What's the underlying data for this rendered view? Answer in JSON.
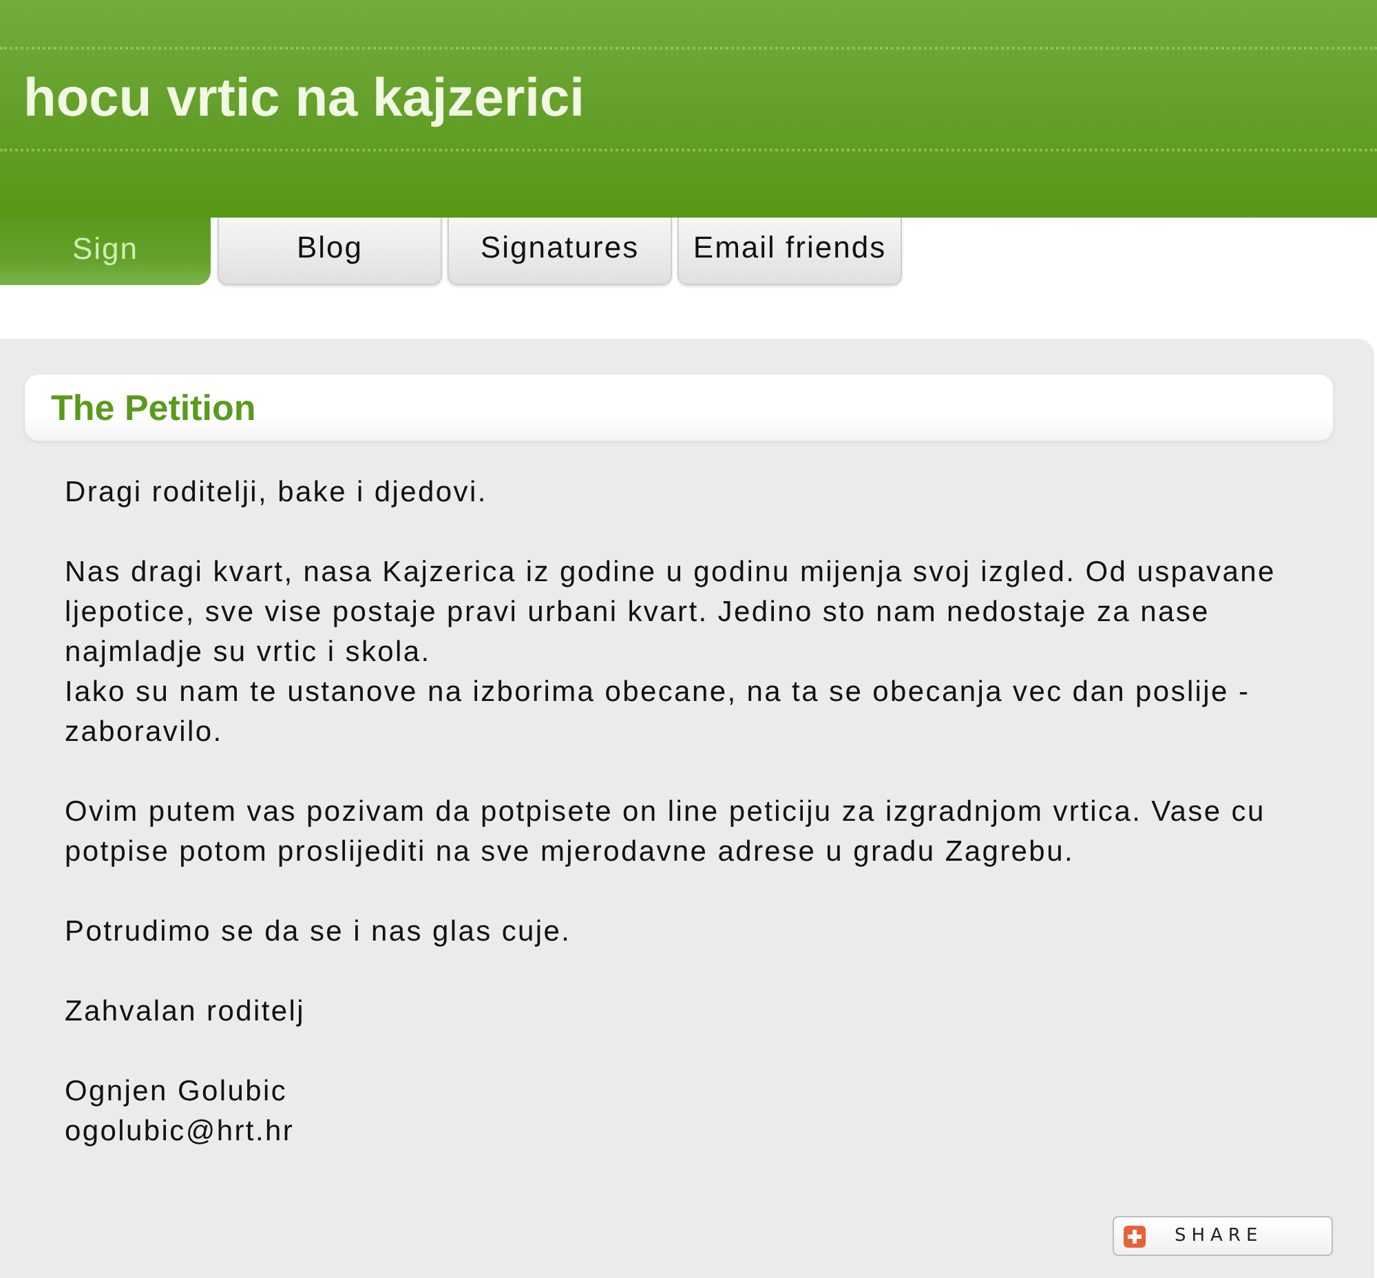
{
  "site": {
    "title": "hocu vrtic na kajzerici"
  },
  "tabs": [
    {
      "label": "Sign",
      "selected": true
    },
    {
      "label": "Blog",
      "selected": false
    },
    {
      "label": "Signatures",
      "selected": false
    },
    {
      "label": "Email friends",
      "selected": false
    }
  ],
  "petition": {
    "heading": "The Petition",
    "paragraphs": [
      "Dragi roditelji, bake i djedovi.",
      "Nas dragi kvart, nasa Kajzerica iz godine u godinu mijenja svoj izgled. Od uspavane ljepotice, sve vise postaje pravi urbani kvart. Jedino sto nam nedostaje za nase najmladje su vrtic i skola.\nIako su nam te ustanove na izborima obecane, na ta se obecanja vec dan poslije - zaboravilo.",
      "Ovim putem vas pozivam da potpisete on line peticiju za izgradnjom vrtica. Vase cu potpise potom proslijediti na sve mjerodavne adrese u gradu Zagrebu.",
      "Potrudimo se da se i nas glas cuje.",
      "Zahvalan roditelj"
    ],
    "signature": {
      "name": "Ognjen Golubic",
      "email": "ogolubic@hrt.hr"
    }
  },
  "share_button": {
    "label": "SHARE"
  }
}
